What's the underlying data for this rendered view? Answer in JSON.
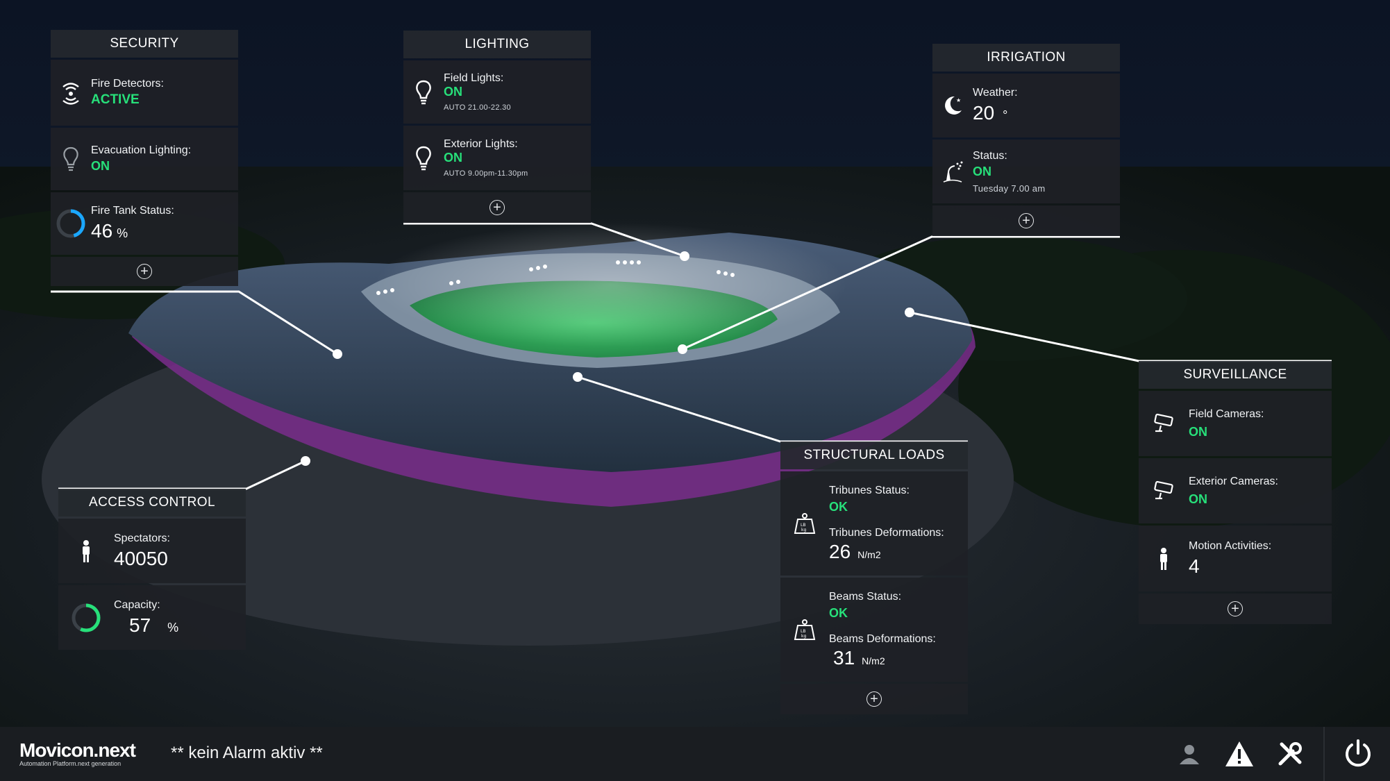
{
  "colors": {
    "active_green": "#27e07a",
    "panel_bg": "#1e2126",
    "accent_blue": "#1aa7ff"
  },
  "security": {
    "title": "SECURITY",
    "fire_detectors_label": "Fire Detectors:",
    "fire_detectors_value": "ACTIVE",
    "evac_label": "Evacuation Lighting:",
    "evac_value": "ON",
    "tank_label": "Fire Tank Status:",
    "tank_value": "46",
    "tank_unit": "%"
  },
  "lighting": {
    "title": "LIGHTING",
    "field_label": "Field Lights:",
    "field_value": "ON",
    "field_sub": "AUTO  21.00-22.30",
    "exterior_label": "Exterior Lights:",
    "exterior_value": "ON",
    "exterior_sub": "AUTO  9.00pm-11.30pm"
  },
  "irrigation": {
    "title": "IRRIGATION",
    "weather_label": "Weather:",
    "weather_value": "20",
    "weather_unit": "°",
    "status_label": "Status:",
    "status_value": "ON",
    "status_sub": "Tuesday  7.00 am"
  },
  "surveillance": {
    "title": "SURVEILLANCE",
    "field_cam_label": "Field Cameras:",
    "field_cam_value": "ON",
    "ext_cam_label": "Exterior Cameras:",
    "ext_cam_value": "ON",
    "motion_label": "Motion Activities:",
    "motion_value": "4"
  },
  "structural": {
    "title": "STRUCTURAL LOADS",
    "tribunes_status_label": "Tribunes Status:",
    "tribunes_status_value": "OK",
    "tribunes_def_label": "Tribunes Deformations:",
    "tribunes_def_value": "26",
    "tribunes_def_unit": "N/m2",
    "beams_status_label": "Beams Status:",
    "beams_status_value": "OK",
    "beams_def_label": "Beams Deformations:",
    "beams_def_value": "31",
    "beams_def_unit": "N/m2"
  },
  "access": {
    "title": "ACCESS CONTROL",
    "spectators_label": "Spectators:",
    "spectators_value": "40050",
    "capacity_label": "Capacity:",
    "capacity_value": "57",
    "capacity_unit": "%"
  },
  "gauges": {
    "fire_tank_fraction": 0.46,
    "capacity_fraction": 0.57
  },
  "bottombar": {
    "logo": "Movicon.next",
    "logo_sub": "Automation Platform.next generation",
    "alarm": "** kein Alarm aktiv **"
  }
}
